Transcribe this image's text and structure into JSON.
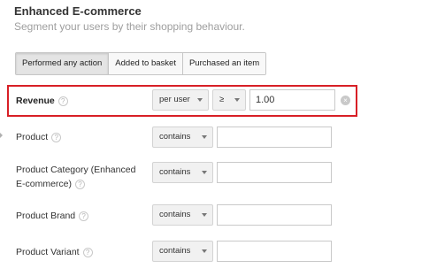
{
  "section": {
    "title": "Enhanced E-commerce",
    "subtitle": "Segment your users by their shopping behaviour."
  },
  "tabs": [
    {
      "label": "Performed any action",
      "active": true
    },
    {
      "label": "Added to basket",
      "active": false
    },
    {
      "label": "Purchased an item",
      "active": false
    }
  ],
  "filters": [
    {
      "label": "Revenue",
      "scope": "per user",
      "operator": "≥",
      "value": "1.00"
    },
    {
      "label": "Product",
      "operator": "contains",
      "value": ""
    },
    {
      "label_line1": "Product Category (Enhanced",
      "label_line2": "E-commerce)",
      "operator": "contains",
      "value": ""
    },
    {
      "label": "Product Brand",
      "operator": "contains",
      "value": ""
    },
    {
      "label": "Product Variant",
      "operator": "contains",
      "value": ""
    }
  ],
  "help_glyph": "?",
  "clear_glyph": "×",
  "colors": {
    "highlight_border": "#d81f26"
  }
}
